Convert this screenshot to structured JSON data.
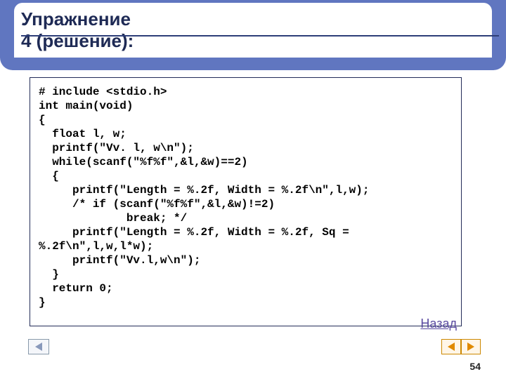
{
  "title": "Упражнение 4 (решение):",
  "code_lines": [
    "# include <stdio.h>",
    "int main(void)",
    "{",
    "  float l, w;",
    "  printf(\"Vv. l, w\\n\");",
    "  while(scanf(\"%f%f\",&l,&w)==2)",
    "  {",
    "     printf(\"Length = %.2f, Width = %.2f\\n\",l,w);",
    "     /* if (scanf(\"%f%f\",&l,&w)!=2)",
    "             break; */",
    "     printf(\"Length = %.2f, Width = %.2f, Sq =",
    "%.2f\\n\",l,w,l*w);",
    "     printf(\"Vv.l,w\\n\");",
    "  }",
    "  return 0;",
    "}"
  ],
  "back_link": "Назад",
  "page_number": "54"
}
